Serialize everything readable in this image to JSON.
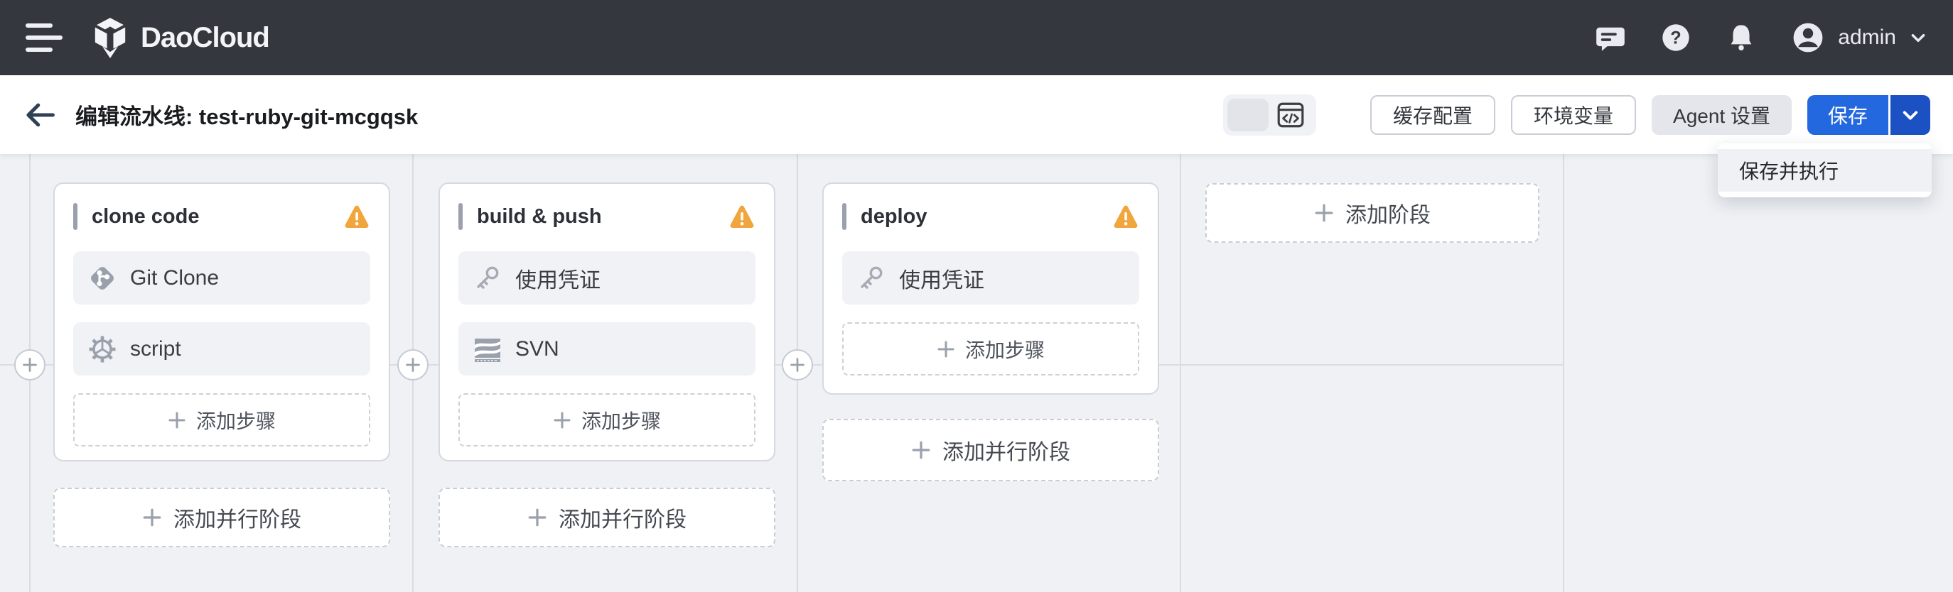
{
  "topbar": {
    "brand": "DaoCloud",
    "user": "admin"
  },
  "header": {
    "title": "编辑流水线: test-ruby-git-mcgqsk",
    "cache_button": "缓存配置",
    "env_button": "环境变量",
    "agent_button": "Agent 设置",
    "save_button": "保存"
  },
  "dropdown": {
    "save_and_run": "保存并执行"
  },
  "pipeline": {
    "stages": [
      {
        "title": "clone code",
        "steps": [
          {
            "label": "Git Clone",
            "icon": "git-icon"
          },
          {
            "label": "script",
            "icon": "gear-icon"
          }
        ]
      },
      {
        "title": "build & push",
        "steps": [
          {
            "label": "使用凭证",
            "icon": "key-icon"
          },
          {
            "label": "SVN",
            "icon": "svn-icon"
          }
        ]
      },
      {
        "title": "deploy",
        "steps": [
          {
            "label": "使用凭证",
            "icon": "key-icon"
          }
        ]
      }
    ],
    "add_step_label": "添加步骤",
    "add_stage_label": "添加阶段",
    "add_parallel_label": "添加并行阶段"
  },
  "colors": {
    "topbar": "#34373e",
    "accent_blue": "#2368de",
    "accent_blue_dark": "#1c51c4",
    "warning": "#f0a63c",
    "canvas": "#eff1f5"
  }
}
